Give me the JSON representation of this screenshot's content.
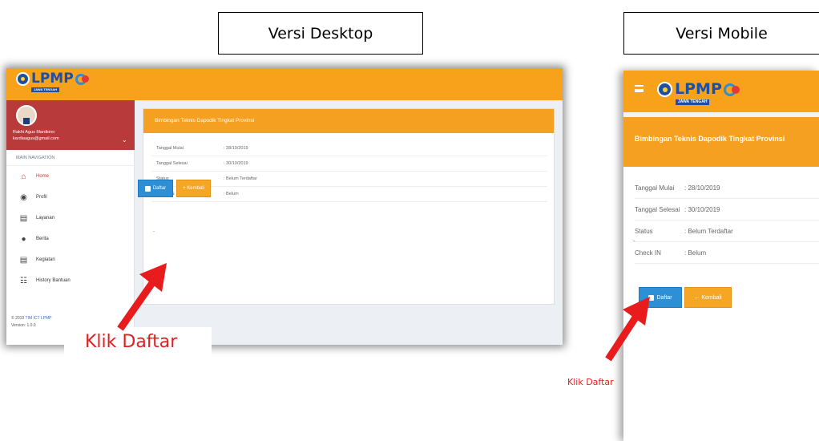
{
  "captions": {
    "desktop": "Versi Desktop",
    "mobile": "Versi Mobile"
  },
  "brand": {
    "logo_text": "LPMP",
    "logo_sub": "JAWA TENGAH",
    "accent": "#f7a21a",
    "logo_blue": "#1e4fa1"
  },
  "desktop": {
    "user": {
      "name": "Rakhi Agus Mardiono",
      "email": "kardiaagus@gmail.com"
    },
    "main_nav": "MAIN NAVIGATION",
    "menu": [
      {
        "label": "Home",
        "icon": "home-icon",
        "active": true
      },
      {
        "label": "Profil",
        "icon": "user-icon",
        "active": false
      },
      {
        "label": "Layanan",
        "icon": "calendar-icon",
        "active": false
      },
      {
        "label": "Berita",
        "icon": "globe-icon",
        "active": false
      },
      {
        "label": "Kegiatan",
        "icon": "calendar-icon",
        "active": false
      },
      {
        "label": "History Bantuan",
        "icon": "users-icon",
        "active": false
      }
    ],
    "footer": {
      "copyright_prefix": "© 2019",
      "copyright_link": "TIM ICT LPMP",
      "version": "Version: 1.0.0"
    },
    "panel_title": "Bimbingan Teknis Dapodik Tingkat Provinsi",
    "rows": [
      {
        "label": "Tanggal Mulai",
        "value": ": 28/10/2019"
      },
      {
        "label": "Tanggal Selesai",
        "value": ": 30/10/2019"
      },
      {
        "label": "Status",
        "value": ": Belum Terdaftar"
      },
      {
        "label": "Check IN",
        "value": ": Belum"
      }
    ],
    "dash": "-",
    "btn_daftar": "Daftar",
    "btn_kembali": "+ Kembali"
  },
  "mobile": {
    "panel_title": "Bimbingan Teknis Dapodik Tingkat Provinsi",
    "rows": [
      {
        "label": "Tanggal Mulai",
        "value": ": 28/10/2019"
      },
      {
        "label": "Tanggal Selesai",
        "value": ": 30/10/2019"
      },
      {
        "label": "Status",
        "value": ": Belum Terdaftar"
      },
      {
        "label": "Check IN",
        "value": ": Belum"
      }
    ],
    "dash": "-",
    "btn_daftar": "Daftar",
    "btn_kembali": "← Kembali"
  },
  "annotations": {
    "klik_desktop": "Klik Daftar",
    "klik_mobile": "Klik Daftar",
    "arrow_color": "#e81c1c"
  }
}
